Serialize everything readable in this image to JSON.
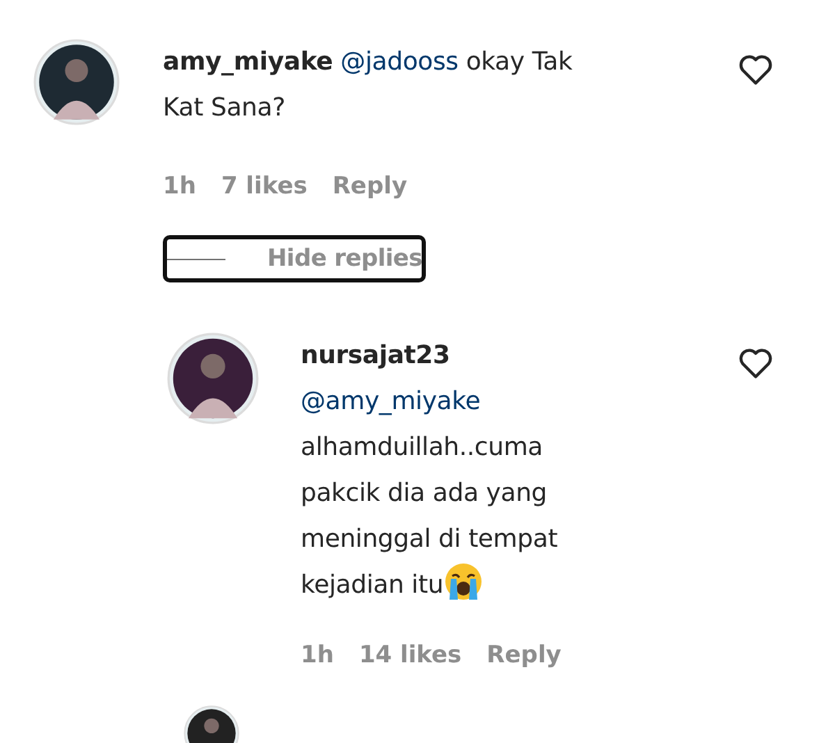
{
  "comments": [
    {
      "username": "amy_miyake",
      "mention": "@jadooss",
      "text": " okay Tak\nKat Sana?",
      "time": "1h",
      "likes": "7 likes",
      "reply": "Reply",
      "liked": false,
      "replies_toggle": "Hide replies",
      "replies": [
        {
          "username": "nursajat23",
          "mention": "@amy_miyake",
          "text": "alhamduillah..cuma\npakcik dia ada yang\nmeninggal di tempat\nkejadian itu",
          "time": "1h",
          "likes": "14 likes",
          "reply": "Reply",
          "liked": false
        }
      ]
    }
  ]
}
